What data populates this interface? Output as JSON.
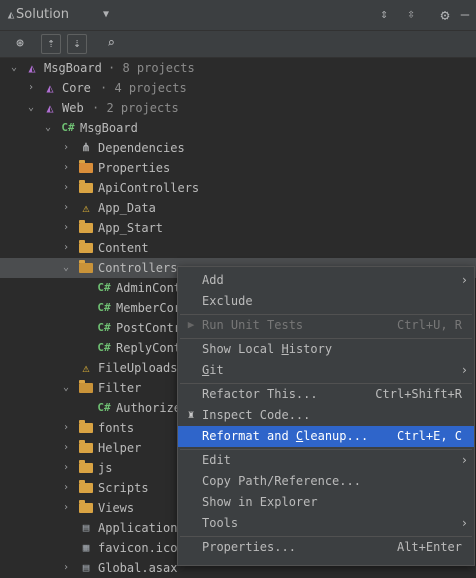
{
  "header": {
    "title": "Solution"
  },
  "tree": {
    "rows": [
      {
        "name": "MsgBoard",
        "meta": "· 8 projects"
      },
      {
        "name": "Core",
        "meta": "· 4 projects"
      },
      {
        "name": "Web",
        "meta": "· 2 projects"
      },
      {
        "name": "MsgBoard"
      },
      {
        "name": "Dependencies"
      },
      {
        "name": "Properties"
      },
      {
        "name": "ApiControllers"
      },
      {
        "name": "App_Data"
      },
      {
        "name": "App_Start"
      },
      {
        "name": "Content"
      },
      {
        "name": "Controllers"
      },
      {
        "name": "AdminCont"
      },
      {
        "name": "MemberCor"
      },
      {
        "name": "PostContr"
      },
      {
        "name": "ReplyCont"
      },
      {
        "name": "FileUploads"
      },
      {
        "name": "Filter"
      },
      {
        "name": "Authorize"
      },
      {
        "name": "fonts"
      },
      {
        "name": "Helper"
      },
      {
        "name": "js"
      },
      {
        "name": "Scripts"
      },
      {
        "name": "Views"
      },
      {
        "name": "Application"
      },
      {
        "name": "favicon.ico"
      },
      {
        "name": "Global.asax"
      }
    ]
  },
  "menu": {
    "add": "Add",
    "exclude": "Exclude",
    "run_unit_tests": "Run Unit Tests",
    "run_unit_tests_shortcut": "Ctrl+U, R",
    "show_local_history_pre": "Show Local ",
    "show_local_history_u": "H",
    "show_local_history_post": "istory",
    "git_u": "G",
    "git_post": "it",
    "refactor_this": "Refactor This...",
    "refactor_this_shortcut": "Ctrl+Shift+R",
    "inspect_code": "Inspect Code...",
    "reformat_pre": "Reformat and ",
    "reformat_u": "C",
    "reformat_post": "leanup...",
    "reformat_shortcut": "Ctrl+E, C",
    "edit": "Edit",
    "copy_path": "Copy Path/Reference...",
    "show_in_explorer": "Show in Explorer",
    "tools": "Tools",
    "properties": "Properties...",
    "properties_shortcut": "Alt+Enter"
  }
}
